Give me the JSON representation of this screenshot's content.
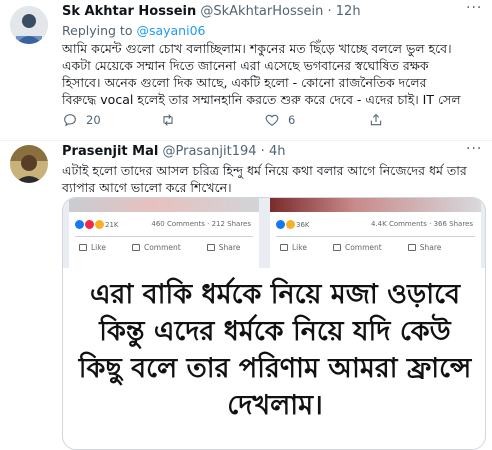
{
  "tweets": [
    {
      "name": "Sk Akhtar Hossein",
      "handle": "@SkAkhtarHossein",
      "dot": "·",
      "time": "12h",
      "replying_prefix": "Replying to ",
      "replying_to": "@sayani06",
      "lines": [
        "আমি কমেন্ট গুলো চোখ বলাচ্ছিলাম। শকুনের মত ছিঁড়ে খাচ্ছে বললে ভুল হবে।",
        "একটা মেয়েকে সম্মান দিতে জানেনা এরা এসেছে ভগবানের স্বঘোষিত রক্ষক",
        "হিসাবে। অনেক গুলো দিক আছে, একটি হলো - কোনো রাজনৈতিক দলের",
        "বিরুদ্ধে vocal হলেই তার সম্মানহানি করতে শুরু করে দেবে - এদের চাই। IT সেল"
      ],
      "reply_count": "20",
      "retweet_count": "",
      "like_count": "6"
    },
    {
      "name": "Prasenjit Mal",
      "handle": "@Prasanjit194",
      "dot": "·",
      "time": "4h",
      "lines": [
        "এটাই হলো তাদের আসল চরিত্র হিন্দু ধর্ম নিয়ে কথা বলার আগে নিজেদের ধর্ম তার",
        "ব্যাপার আগে ভালো করে শিখেনে।"
      ],
      "media": {
        "left_card": {
          "reactions": "21K",
          "comments_shares": "460 Comments · 212 Shares",
          "like": "Like",
          "comment": "Comment",
          "share": "Share"
        },
        "right_card": {
          "reactions": "36K",
          "comments_shares": "4.4K Comments · 366 Shares",
          "like": "Like",
          "comment": "Comment",
          "share": "Share"
        },
        "caption_lines": [
          "এরা বাকি ধর্মকে নিয়ে মজা ওড়াবে",
          "কিন্তু এদের ধর্মকে নিয়ে যদি কেউ",
          "কিছু বলে তার পরিণাম আমরা ফ্রান্সে",
          "দেখলাম।"
        ]
      }
    }
  ],
  "icons": {
    "more": "more-horizontal-icon",
    "reply": "reply-icon",
    "retweet": "retweet-icon",
    "like": "heart-icon",
    "share": "share-icon"
  },
  "colors": {
    "link": "#1d9bf0",
    "secondary_text": "#536471",
    "divider": "#eff3f4"
  }
}
